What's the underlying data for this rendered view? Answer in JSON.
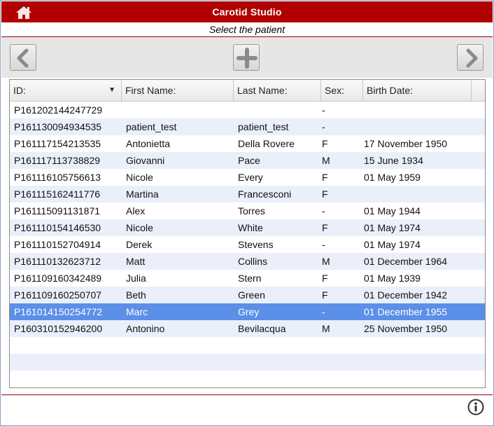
{
  "app": {
    "title": "Carotid Studio",
    "subtitle": "Select the patient"
  },
  "toolbar": {
    "prev_icon": "chevron-left-icon",
    "add_icon": "plus-icon",
    "next_icon": "chevron-right-icon"
  },
  "table": {
    "columns": [
      "ID:",
      "First Name:",
      "Last Name:",
      "Sex:",
      "Birth Date:"
    ],
    "sort_icon": "▼",
    "rows": [
      [
        "P161202144247729",
        "",
        "",
        "-",
        ""
      ],
      [
        "P161130094934535",
        "patient_test",
        "patient_test",
        "-",
        ""
      ],
      [
        "P161117154213535",
        "Antonietta",
        "Della Rovere",
        "F",
        "17 November 1950"
      ],
      [
        "P161117113738829",
        "Giovanni",
        "Pace",
        "M",
        "15 June 1934"
      ],
      [
        "P161116105756613",
        "Nicole",
        "Every",
        "F",
        "01 May 1959"
      ],
      [
        "P161115162411776",
        "Martina",
        "Francesconi",
        "F",
        ""
      ],
      [
        "P161115091131871",
        "Alex",
        "Torres",
        "-",
        "01 May 1944"
      ],
      [
        "P161110154146530",
        "Nicole",
        "White",
        "F",
        "01 May 1974"
      ],
      [
        "P161110152704914",
        "Derek",
        "Stevens",
        "-",
        "01 May 1974"
      ],
      [
        "P161110132623712",
        "Matt",
        "Collins",
        "M",
        "01 December 1964"
      ],
      [
        "P161109160342489",
        "Julia",
        "Stern",
        "F",
        "01 May 1939"
      ],
      [
        "P161109160250707",
        "Beth",
        "Green",
        "F",
        "01 December 1942"
      ],
      [
        "P161014150254772",
        "Marc",
        "Grey",
        "-",
        "01 December 1955"
      ],
      [
        "P160310152946200",
        "Antonino",
        "Bevilacqua",
        "M",
        "25 November 1950"
      ],
      [
        "",
        "",
        "",
        "",
        ""
      ],
      [
        "",
        "",
        "",
        "",
        ""
      ],
      [
        "",
        "",
        "",
        "",
        ""
      ]
    ],
    "selected_row": 12
  },
  "colors": {
    "titlebar": "#b00000",
    "selection": "#5b8fe8",
    "stripe": "#eaeffa"
  },
  "footer": {
    "info_icon": "info-icon"
  }
}
